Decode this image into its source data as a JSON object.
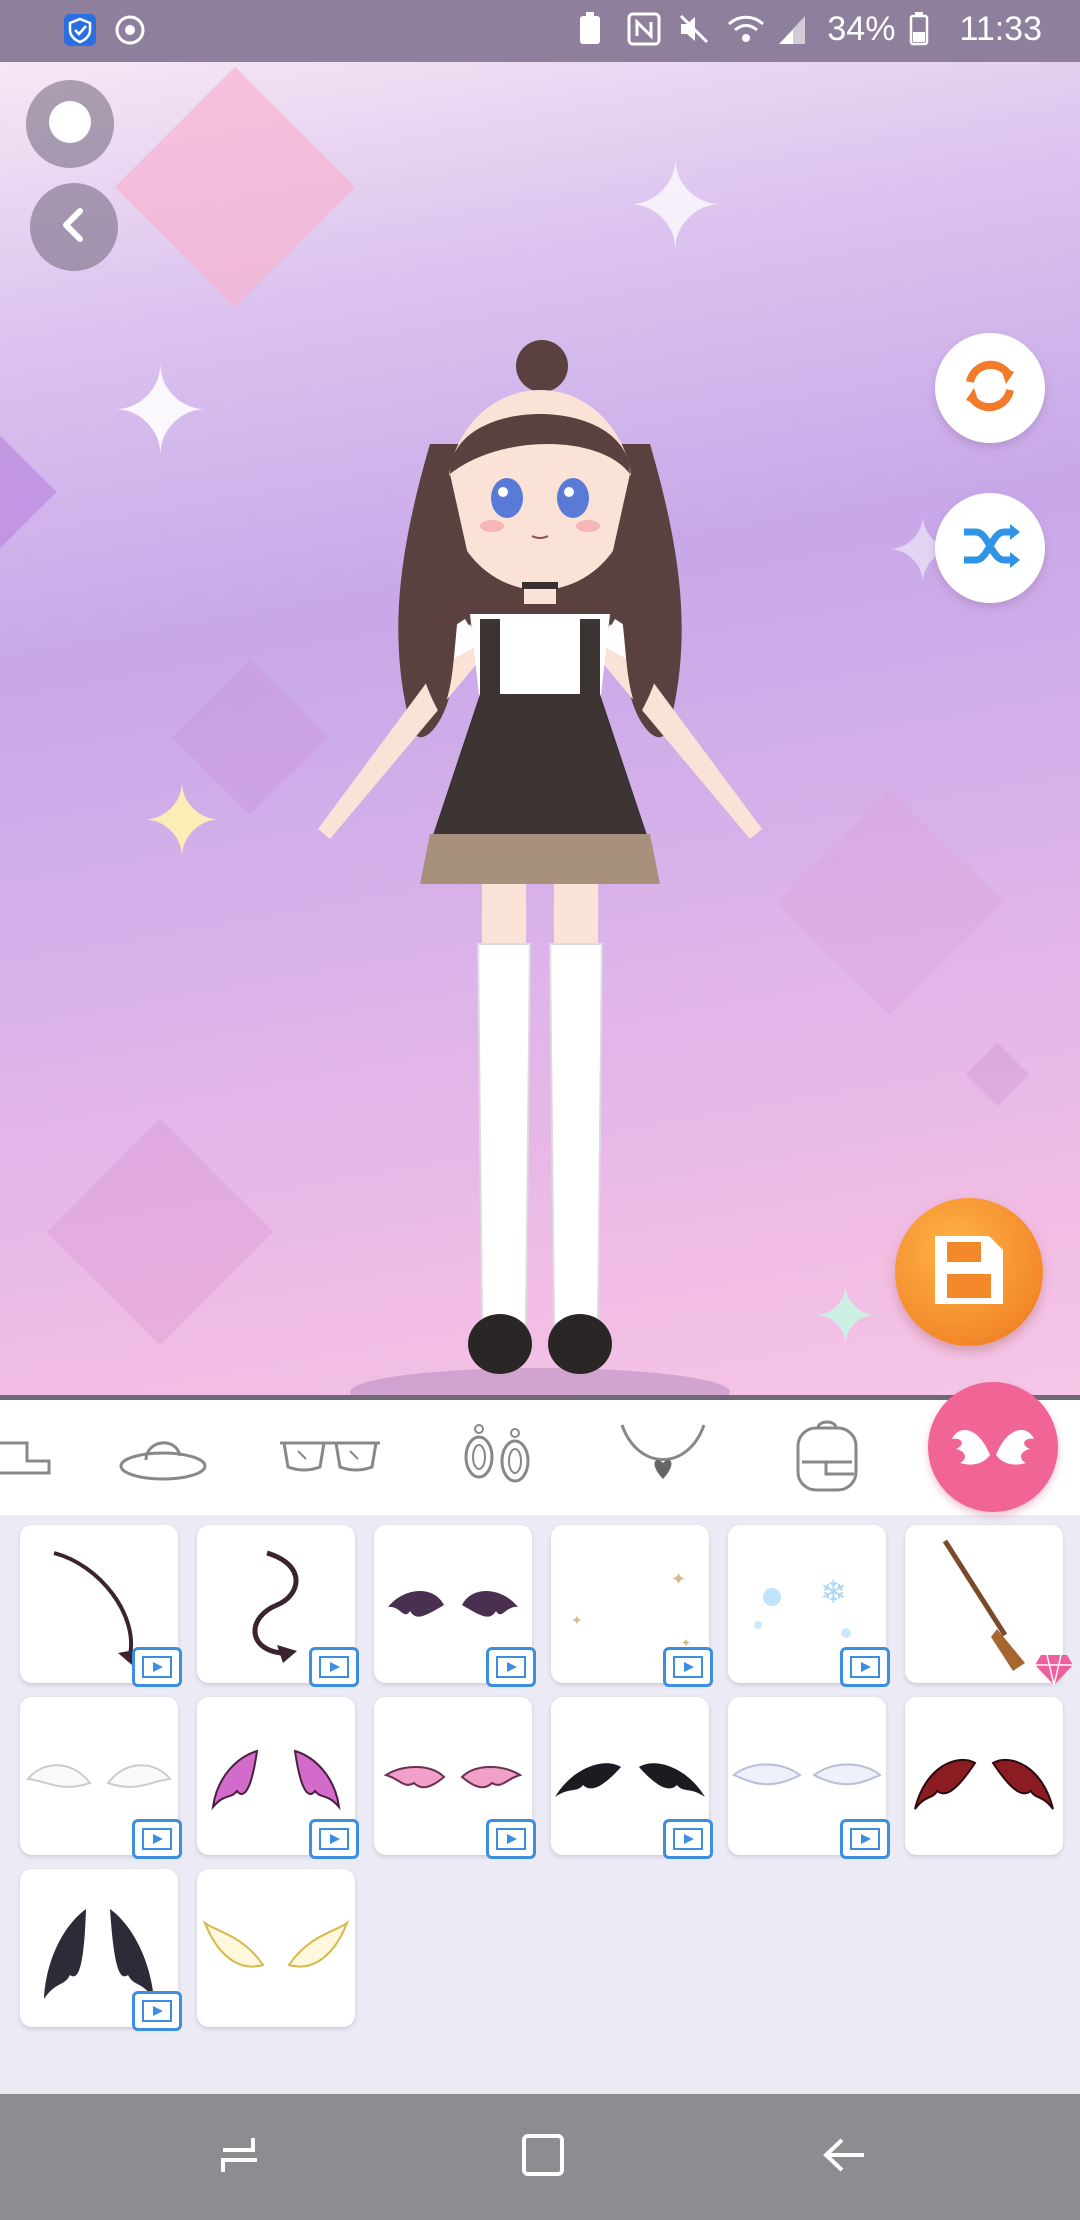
{
  "status_bar": {
    "battery_percent": "34%",
    "time": "11:33",
    "left_icons": [
      "shield-check-icon",
      "sync-icon"
    ],
    "right_icons": [
      "battery-saver-icon",
      "nfc-icon",
      "mute-icon",
      "wifi-icon",
      "signal-icon",
      "battery-icon"
    ]
  },
  "stage": {
    "top_buttons": [
      "record-icon",
      "back-icon"
    ],
    "side_buttons": [
      "reset-icon",
      "shuffle-icon"
    ],
    "save_button": "save-icon",
    "colors": {
      "reset": "#f27a2b",
      "shuffle": "#2f93e6",
      "save": "#f3892a"
    }
  },
  "categories": {
    "items": [
      "shoes-icon",
      "hat-icon",
      "glasses-icon",
      "earrings-icon",
      "necklace-icon",
      "backpack-icon",
      "wings-icon"
    ],
    "active": "wings-icon",
    "active_color": "#f06496"
  },
  "items": [
    {
      "name": "devil-tail-1",
      "badge": "video"
    },
    {
      "name": "devil-tail-2",
      "badge": "video"
    },
    {
      "name": "bat-wings-small",
      "badge": "video"
    },
    {
      "name": "sparkles",
      "badge": "video"
    },
    {
      "name": "snowflakes",
      "badge": "video"
    },
    {
      "name": "broom",
      "badge": "gem"
    },
    {
      "name": "angel-wings-white",
      "badge": "video"
    },
    {
      "name": "pink-bat-wings",
      "badge": "video"
    },
    {
      "name": "pink-bat-wings-small",
      "badge": "video"
    },
    {
      "name": "black-bat-wings",
      "badge": "video"
    },
    {
      "name": "feather-wings",
      "badge": "video"
    },
    {
      "name": "red-bat-wings",
      "badge": "none"
    },
    {
      "name": "dark-feather-wings",
      "badge": "video"
    },
    {
      "name": "golden-angel-wings",
      "badge": "none"
    }
  ],
  "navbar": {
    "buttons": [
      "recent-apps-icon",
      "home-icon",
      "back-nav-icon"
    ]
  }
}
